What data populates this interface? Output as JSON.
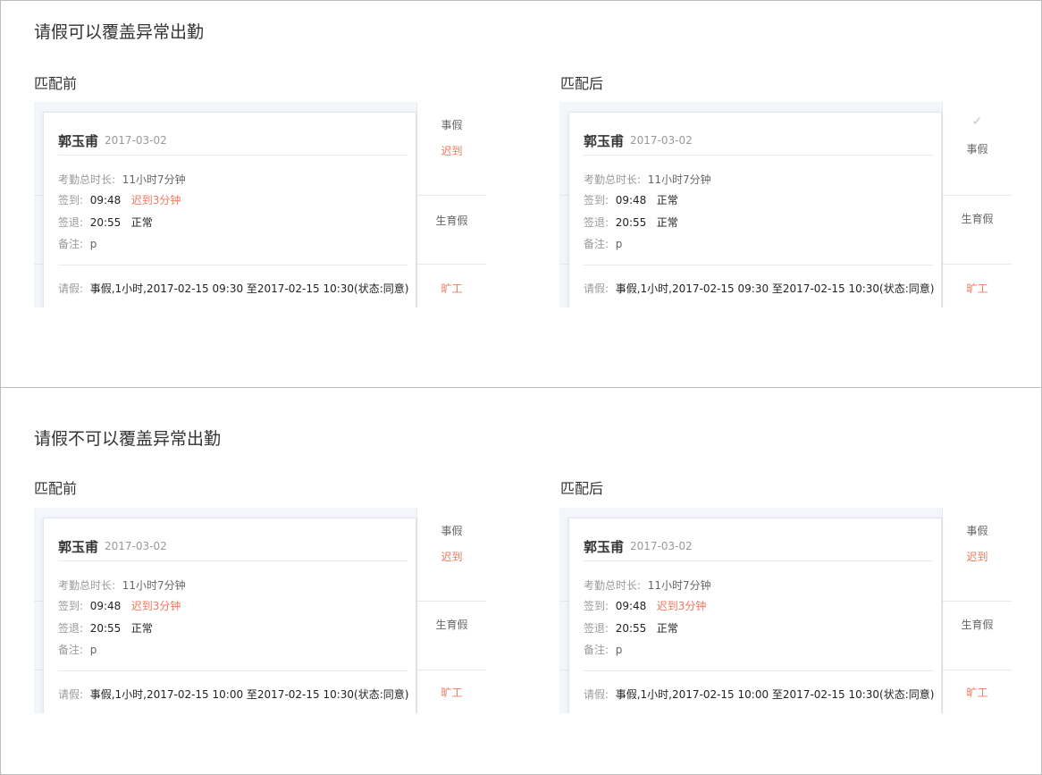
{
  "sections": [
    {
      "title": "请假可以覆盖异常出勤",
      "panels": [
        {
          "title": "匹配前",
          "card": {
            "name": "郭玉甫",
            "date": "2017-03-02",
            "duration_label": "考勤总时长:",
            "duration_value": "11小时7分钟",
            "signin_label": "签到:",
            "signin_time": "09:48",
            "signin_status": "迟到3分钟",
            "signout_label": "签退:",
            "signout_time": "20:55",
            "signout_status": "正常",
            "note_label": "备注:",
            "note_value": "p",
            "leave_label": "请假:",
            "leave_value": "事假,1小时,2017-02-15 09:30 至2017-02-15 10:30(状态:同意)"
          },
          "side": {
            "cell1_a": "事假",
            "cell1_b": "迟到",
            "cell2": "生育假",
            "cell3": "旷工"
          }
        },
        {
          "title": "匹配后",
          "card": {
            "name": "郭玉甫",
            "date": "2017-03-02",
            "duration_label": "考勤总时长:",
            "duration_value": "11小时7分钟",
            "signin_label": "签到:",
            "signin_time": "09:48",
            "signin_status": "正常",
            "signout_label": "签退:",
            "signout_time": "20:55",
            "signout_status": "正常",
            "note_label": "备注:",
            "note_value": "p",
            "leave_label": "请假:",
            "leave_value": "事假,1小时,2017-02-15 09:30 至2017-02-15 10:30(状态:同意)"
          },
          "side": {
            "check": "✓",
            "cell1_a": "事假",
            "cell2": "生育假",
            "cell3": "旷工"
          }
        }
      ]
    },
    {
      "title": "请假不可以覆盖异常出勤",
      "panels": [
        {
          "title": "匹配前",
          "card": {
            "name": "郭玉甫",
            "date": "2017-03-02",
            "duration_label": "考勤总时长:",
            "duration_value": "11小时7分钟",
            "signin_label": "签到:",
            "signin_time": "09:48",
            "signin_status": "迟到3分钟",
            "signout_label": "签退:",
            "signout_time": "20:55",
            "signout_status": "正常",
            "note_label": "备注:",
            "note_value": "p",
            "leave_label": "请假:",
            "leave_value": "事假,1小时,2017-02-15 10:00 至2017-02-15 10:30(状态:同意)"
          },
          "side": {
            "cell1_a": "事假",
            "cell1_b": "迟到",
            "cell2": "生育假",
            "cell3": "旷工"
          }
        },
        {
          "title": "匹配后",
          "card": {
            "name": "郭玉甫",
            "date": "2017-03-02",
            "duration_label": "考勤总时长:",
            "duration_value": "11小时7分钟",
            "signin_label": "签到:",
            "signin_time": "09:48",
            "signin_status": "迟到3分钟",
            "signout_label": "签退:",
            "signout_time": "20:55",
            "signout_status": "正常",
            "note_label": "备注:",
            "note_value": "p",
            "leave_label": "请假:",
            "leave_value": "事假,1小时,2017-02-15 10:00 至2017-02-15 10:30(状态:同意)"
          },
          "side": {
            "cell1_a": "事假",
            "cell1_b": "迟到",
            "cell2": "生育假",
            "cell3": "旷工"
          }
        }
      ]
    }
  ],
  "colors": {
    "late": "#f0775d",
    "absent": "#f0775d",
    "check": "#c4c4c4",
    "border": "#bdbdbd"
  },
  "icons": {
    "approved": "check-icon"
  }
}
